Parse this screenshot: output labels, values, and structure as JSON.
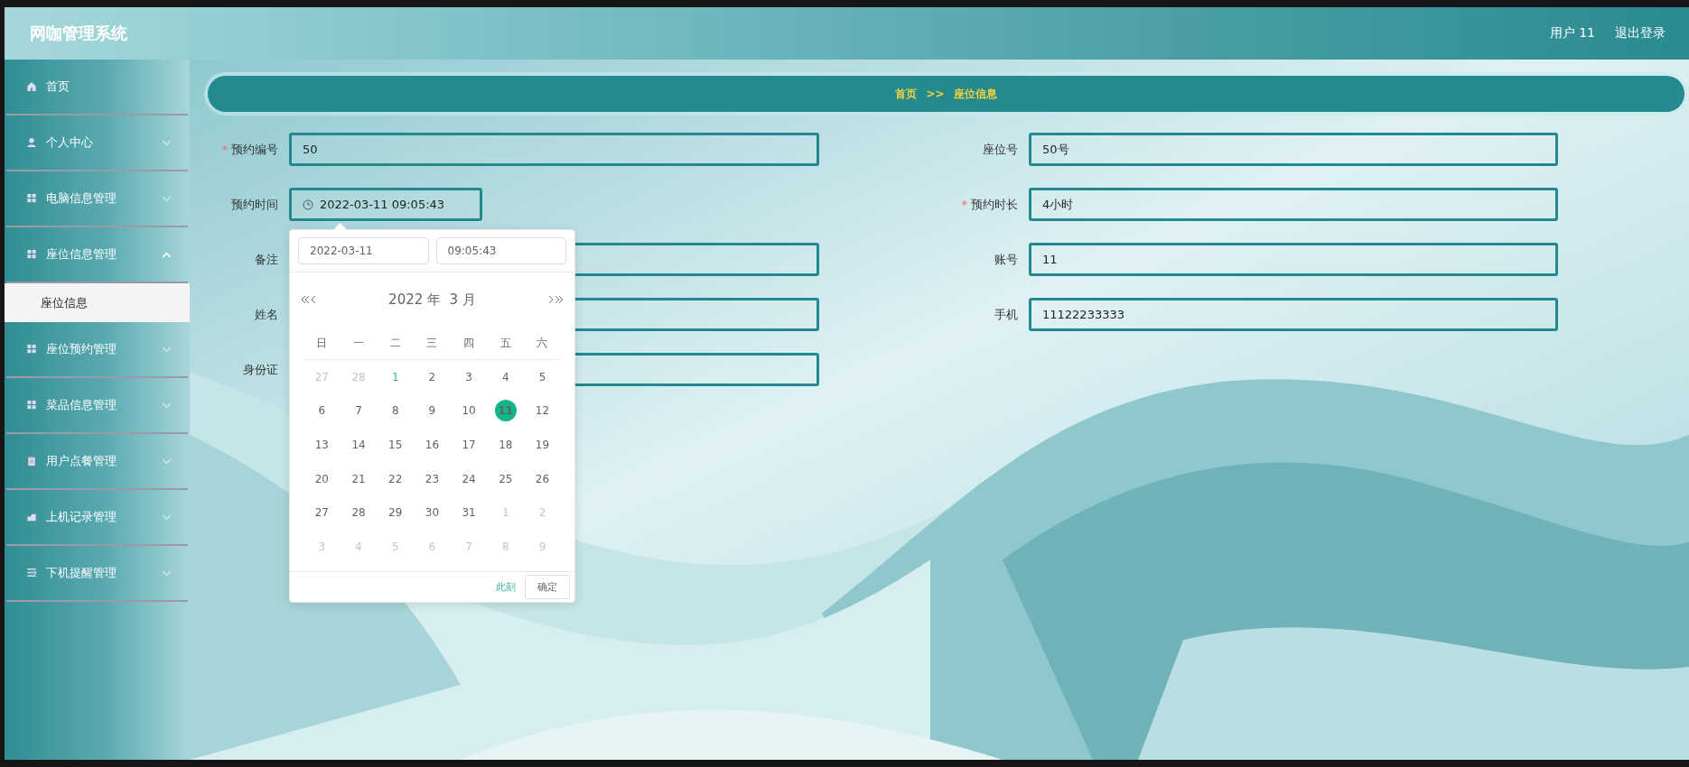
{
  "header": {
    "title": "网咖管理系统",
    "user": "用户 11",
    "logout": "退出登录"
  },
  "sidebar": {
    "items": [
      {
        "label": "首页",
        "kind": "link"
      },
      {
        "label": "个人中心",
        "kind": "menu",
        "expanded": false
      },
      {
        "label": "电脑信息管理",
        "kind": "menu",
        "expanded": false
      },
      {
        "label": "座位信息管理",
        "kind": "menu",
        "expanded": true,
        "children": [
          {
            "label": "座位信息",
            "selected": true
          }
        ]
      },
      {
        "label": "座位预约管理",
        "kind": "menu",
        "expanded": false
      },
      {
        "label": "菜品信息管理",
        "kind": "menu",
        "expanded": false
      },
      {
        "label": "用户点餐管理",
        "kind": "menu",
        "expanded": false
      },
      {
        "label": "上机记录管理",
        "kind": "menu",
        "expanded": false
      },
      {
        "label": "下机提醒管理",
        "kind": "menu",
        "expanded": false
      }
    ]
  },
  "breadcrumb": {
    "items": [
      "首页",
      "座位信息"
    ],
    "separator": ">>"
  },
  "form": {
    "required_mark": "*",
    "fields": [
      {
        "label": "预约编号",
        "value": "50",
        "required": true,
        "kind": "text"
      },
      {
        "label": "座位号",
        "value": "50号",
        "required": false,
        "kind": "text"
      },
      {
        "label": "预约时间",
        "value": "2022-03-11 09:05:43",
        "required": false,
        "kind": "datetime"
      },
      {
        "label": "预约时长",
        "value": "4小时",
        "required": true,
        "kind": "text"
      },
      {
        "label": "备注",
        "required": false,
        "kind": "text"
      },
      {
        "label": "账号",
        "value": "11",
        "required": false,
        "kind": "text"
      },
      {
        "label": "姓名",
        "required": false,
        "kind": "text"
      },
      {
        "label": "手机",
        "value": "11122233333",
        "required": false,
        "kind": "text"
      },
      {
        "label": "身份证",
        "required": false,
        "kind": "text"
      }
    ]
  },
  "date_picker": {
    "date": "2022-03-11",
    "time": "09:05:43",
    "title": "2022 年  3 月",
    "weekdays": [
      "日",
      "一",
      "二",
      "三",
      "四",
      "五",
      "六"
    ],
    "days": [
      {
        "label": "27",
        "kind": "other",
        "selected": false
      },
      {
        "label": "28",
        "kind": "other",
        "selected": false
      },
      {
        "label": "1",
        "kind": "today",
        "selected": false
      },
      {
        "label": "2",
        "kind": "current",
        "selected": false
      },
      {
        "label": "3",
        "kind": "current",
        "selected": false
      },
      {
        "label": "4",
        "kind": "current",
        "selected": false
      },
      {
        "label": "5",
        "kind": "current",
        "selected": false
      },
      {
        "label": "6",
        "kind": "current",
        "selected": false
      },
      {
        "label": "7",
        "kind": "current",
        "selected": false
      },
      {
        "label": "8",
        "kind": "current",
        "selected": false
      },
      {
        "label": "9",
        "kind": "current",
        "selected": false
      },
      {
        "label": "10",
        "kind": "current",
        "selected": false
      },
      {
        "label": "11",
        "kind": "current",
        "selected": true
      },
      {
        "label": "12",
        "kind": "current",
        "selected": false
      },
      {
        "label": "13",
        "kind": "current",
        "selected": false
      },
      {
        "label": "14",
        "kind": "current",
        "selected": false
      },
      {
        "label": "15",
        "kind": "current",
        "selected": false
      },
      {
        "label": "16",
        "kind": "current",
        "selected": false
      },
      {
        "label": "17",
        "kind": "current",
        "selected": false
      },
      {
        "label": "18",
        "kind": "current",
        "selected": false
      },
      {
        "label": "19",
        "kind": "current",
        "selected": false
      },
      {
        "label": "20",
        "kind": "current",
        "selected": false
      },
      {
        "label": "21",
        "kind": "current",
        "selected": false
      },
      {
        "label": "22",
        "kind": "current",
        "selected": false
      },
      {
        "label": "23",
        "kind": "current",
        "selected": false
      },
      {
        "label": "24",
        "kind": "current",
        "selected": false
      },
      {
        "label": "25",
        "kind": "current",
        "selected": false
      },
      {
        "label": "26",
        "kind": "current",
        "selected": false
      },
      {
        "label": "27",
        "kind": "current",
        "selected": false
      },
      {
        "label": "28",
        "kind": "current",
        "selected": false
      },
      {
        "label": "29",
        "kind": "current",
        "selected": false
      },
      {
        "label": "30",
        "kind": "current",
        "selected": false
      },
      {
        "label": "31",
        "kind": "current",
        "selected": false
      },
      {
        "label": "1",
        "kind": "other",
        "selected": false
      },
      {
        "label": "2",
        "kind": "other",
        "selected": false
      },
      {
        "label": "3",
        "kind": "other",
        "selected": false
      },
      {
        "label": "4",
        "kind": "other",
        "selected": false
      },
      {
        "label": "5",
        "kind": "other",
        "selected": false
      },
      {
        "label": "6",
        "kind": "other",
        "selected": false
      },
      {
        "label": "7",
        "kind": "other",
        "selected": false
      },
      {
        "label": "8",
        "kind": "other",
        "selected": false
      },
      {
        "label": "9",
        "kind": "other",
        "selected": false
      }
    ],
    "now_link": "此刻",
    "confirm": "确定"
  }
}
